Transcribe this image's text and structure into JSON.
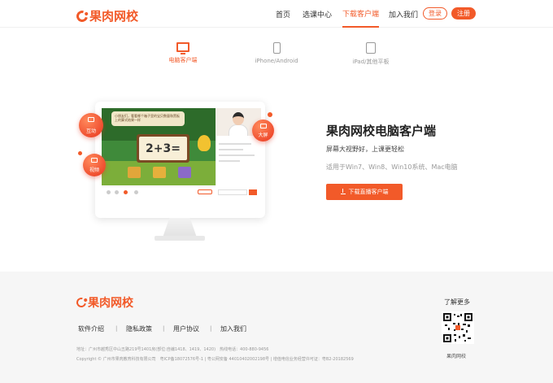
{
  "header": {
    "logo": "果肉网校",
    "nav": [
      "首页",
      "选课中心",
      "下载客户端",
      "加入我们"
    ],
    "active_nav": "下载客户端",
    "login": "登录",
    "register": "注册"
  },
  "tabs": [
    {
      "label": "电脑客户端",
      "icon": "monitor-icon",
      "active": true
    },
    {
      "label": "iPhone/Android",
      "icon": "phone-icon",
      "active": false
    },
    {
      "label": "iPad/其他平板",
      "icon": "tablet-icon",
      "active": false
    }
  ],
  "illustration": {
    "board_text": "2+3=",
    "bubble_text": "小朋友们，看看哪个箱子里的宝贝数量和黑板上的算式结果一样",
    "badge_interact": "互动",
    "badge_screen": "大屏",
    "badge_video": "视频"
  },
  "hero": {
    "title": "果肉网校电脑客户端",
    "subtitle": "屏幕大视野好，上课更轻松",
    "compat": "适用于Win7、Win8、Win10系统、Mac电脑",
    "download_button": "下载直播客户端"
  },
  "footer": {
    "logo": "果肉网校",
    "links": [
      "软件介绍",
      "隐私政策",
      "用户协议",
      "加入我们"
    ],
    "address": "地址：广州市越秀区中山五路219号1401房(部位:自编1418、1419、1420)　热线电话：400-880-9456",
    "copyright": "Copyright © 广州市果肉教育科技有限公司　粤ICP备18072576号-1 | 粤公网安备 44010402002198号 | 增值电信业务经营许可证：粤B2-20182569",
    "more_label": "了解更多",
    "qr_label": "果肉网校"
  },
  "colors": {
    "accent": "#f25a29",
    "footer_bg": "#f6f6f6"
  }
}
